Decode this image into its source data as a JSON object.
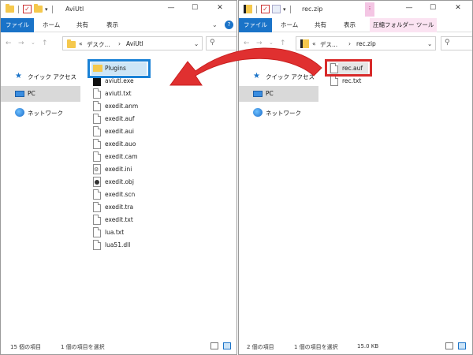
{
  "left_window": {
    "title": "AviUtl",
    "tabs": [
      "ファイル",
      "ホーム",
      "共有",
      "表示"
    ],
    "address": {
      "prefix": "«",
      "parts": [
        "デスク...",
        "AviUtl"
      ],
      "separator": "›"
    },
    "nav": [
      "クイック アクセス",
      "PC",
      "ネットワーク"
    ],
    "files": [
      "Plugins",
      "aviutl.exe",
      "aviutl.txt",
      "exedit.anm",
      "exedit.auf",
      "exedit.aui",
      "exedit.auo",
      "exedit.cam",
      "exedit.ini",
      "exedit.obj",
      "exedit.scn",
      "exedit.tra",
      "exedit.txt",
      "lua.txt",
      "lua51.dll"
    ],
    "status": {
      "count": "15 個の項目",
      "selected": "1 個の項目を選択"
    }
  },
  "right_window": {
    "title": "rec.zip",
    "tabs": [
      "ファイル",
      "ホーム",
      "共有",
      "表示",
      "圧縮フォルダー ツール"
    ],
    "address": {
      "prefix": "«",
      "parts": [
        "デス...",
        "rec.zip"
      ],
      "separator": "›"
    },
    "nav": [
      "クイック アクセス",
      "PC",
      "ネットワーク"
    ],
    "files": [
      "rec.auf",
      "rec.txt"
    ],
    "status": {
      "count": "2 個の項目",
      "selected": "1 個の項目を選択",
      "size": "15.0 KB"
    }
  },
  "colors": {
    "file_tab": "#1a73c8",
    "highlight_blue": "#1a82d6",
    "highlight_red": "#d82a2a",
    "arrow": "#e03030"
  }
}
